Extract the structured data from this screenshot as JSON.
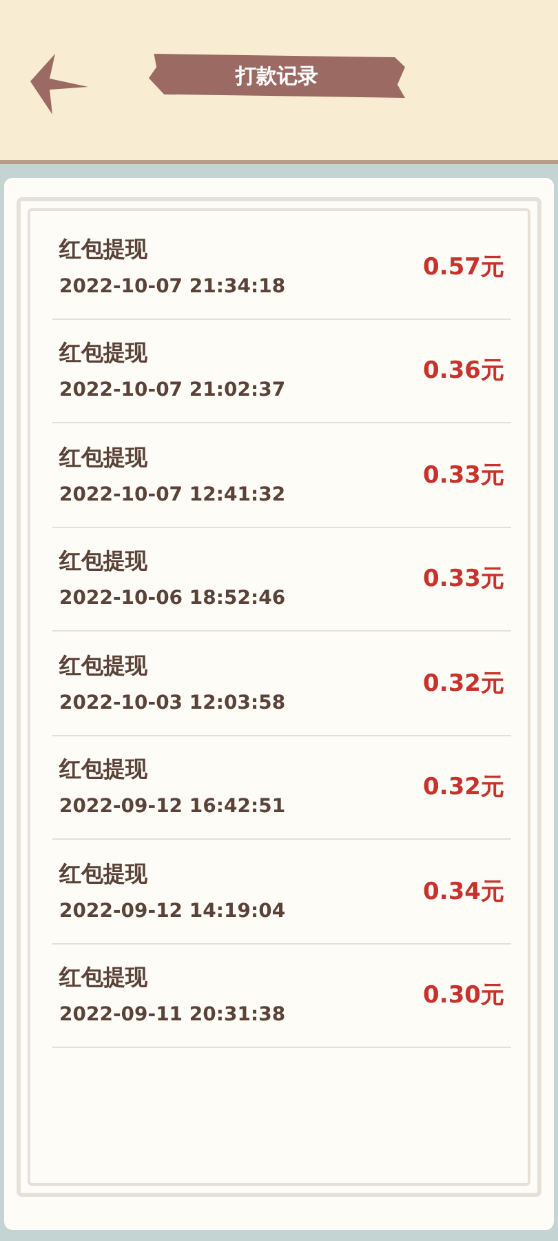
{
  "header": {
    "title": "打款记录"
  },
  "records": [
    {
      "title": "红包提现",
      "time": "2022-10-07 21:34:18",
      "amount": "0.57元"
    },
    {
      "title": "红包提现",
      "time": "2022-10-07 21:02:37",
      "amount": "0.36元"
    },
    {
      "title": "红包提现",
      "time": "2022-10-07 12:41:32",
      "amount": "0.33元"
    },
    {
      "title": "红包提现",
      "time": "2022-10-06 18:52:46",
      "amount": "0.33元"
    },
    {
      "title": "红包提现",
      "time": "2022-10-03 12:03:58",
      "amount": "0.32元"
    },
    {
      "title": "红包提现",
      "time": "2022-09-12 16:42:51",
      "amount": "0.32元"
    },
    {
      "title": "红包提现",
      "time": "2022-09-12 14:19:04",
      "amount": "0.34元"
    },
    {
      "title": "红包提现",
      "time": "2022-09-11 20:31:38",
      "amount": "0.30元"
    }
  ]
}
